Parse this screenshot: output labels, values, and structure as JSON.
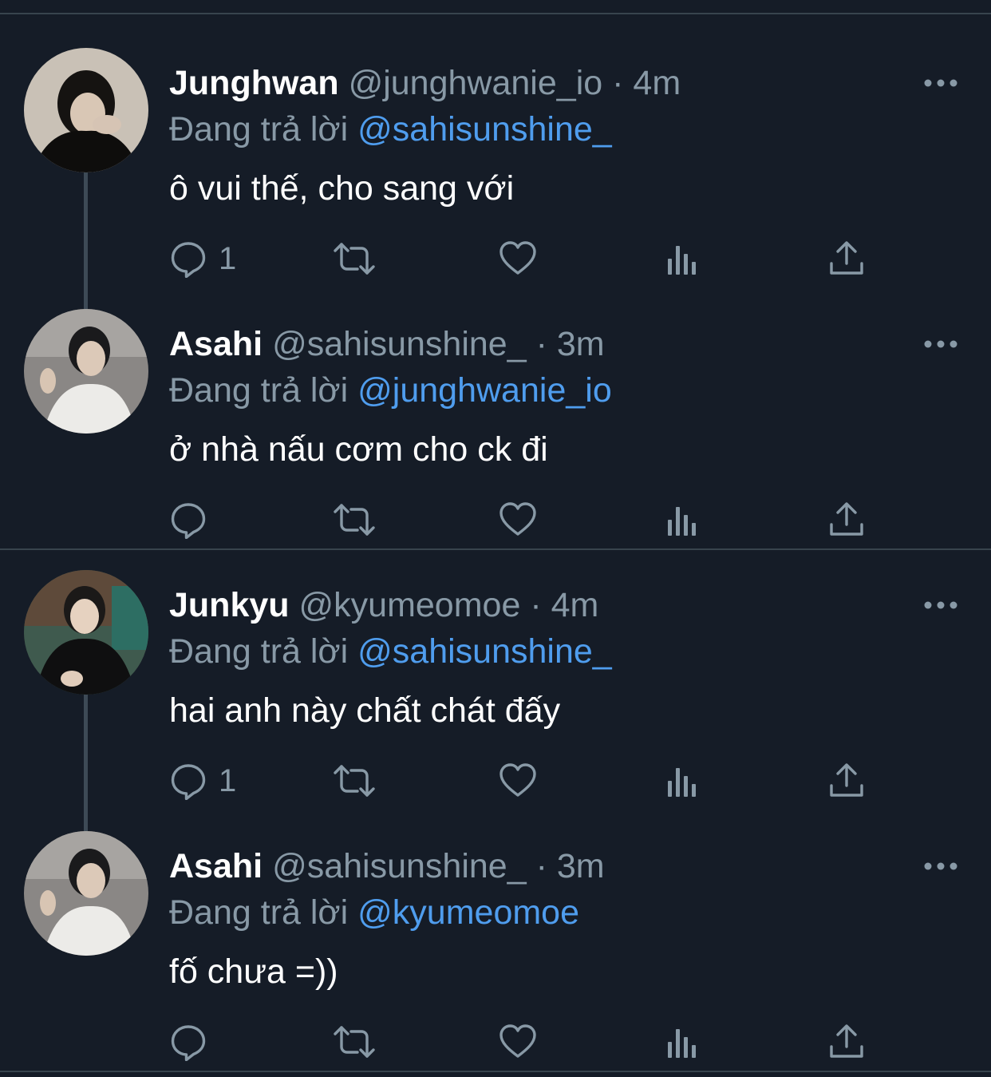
{
  "threads": [
    {
      "tweets": [
        {
          "name": "Junghwan",
          "handle": "@junghwanie_io",
          "separator": "·",
          "time": "4m",
          "reply_prefix": "Đang trả lời",
          "reply_to": "@sahisunshine_",
          "text": "ô vui thế, cho sang với",
          "reply_count": "1"
        },
        {
          "name": "Asahi",
          "handle": "@sahisunshine_",
          "separator": "·",
          "time": "3m",
          "reply_prefix": "Đang trả lời",
          "reply_to": "@junghwanie_io",
          "text": "ở nhà nấu cơm cho ck đi",
          "reply_count": ""
        }
      ]
    },
    {
      "tweets": [
        {
          "name": "Junkyu",
          "handle": "@kyumeomoe",
          "separator": "·",
          "time": "4m",
          "reply_prefix": "Đang trả lời",
          "reply_to": "@sahisunshine_",
          "text": "hai anh này chất chát đấy",
          "reply_count": "1"
        },
        {
          "name": "Asahi",
          "handle": "@sahisunshine_",
          "separator": "·",
          "time": "3m",
          "reply_prefix": "Đang trả lời",
          "reply_to": "@kyumeomoe",
          "text": "fố chưa =))",
          "reply_count": ""
        }
      ]
    }
  ],
  "icons": {
    "reply": "reply-icon",
    "retweet": "retweet-icon",
    "like": "heart-icon",
    "views": "analytics-icon",
    "share": "share-icon",
    "more": "more-icon"
  },
  "colors": {
    "background": "#151c27",
    "mention": "#4f9dee",
    "muted": "#8899a6",
    "divider": "#38444d"
  }
}
